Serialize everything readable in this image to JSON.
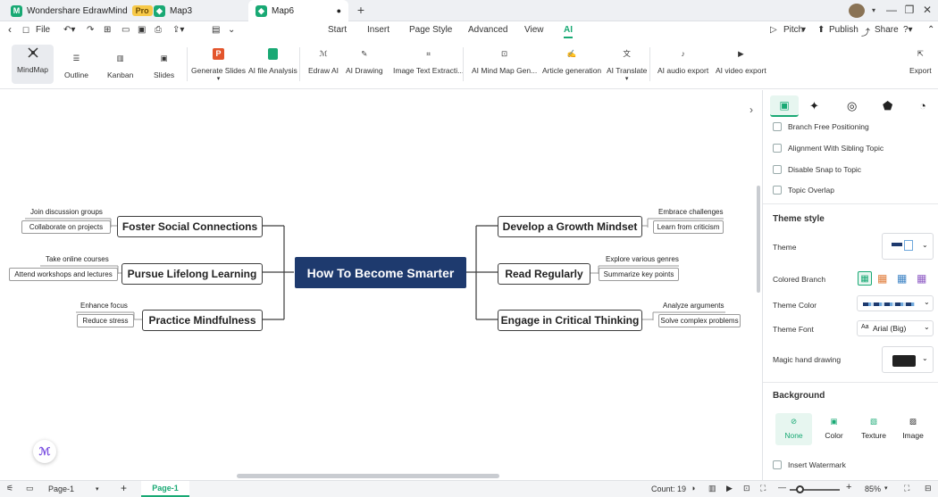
{
  "titlebar": {
    "app_tab": "Wondershare EdrawMind",
    "pro_badge": "Pro",
    "tabs": [
      "Map3",
      "Map6"
    ]
  },
  "menubar": {
    "file": "File",
    "items": [
      "Start",
      "Insert",
      "Page Style",
      "Advanced",
      "View",
      "AI"
    ],
    "active": "AI",
    "right": {
      "pitch": "Pitch",
      "publish": "Publish",
      "share": "Share"
    }
  },
  "ribbon": {
    "views": [
      "MindMap",
      "Outline",
      "Kanban",
      "Slides"
    ],
    "tools": [
      "Generate Slides",
      "AI file Analysis",
      "Edraw AI",
      "AI Drawing",
      "Image Text Extracti...",
      "AI Mind Map Gen...",
      "Article generation",
      "AI Translate",
      "AI audio export",
      "AI video export"
    ],
    "export": "Export"
  },
  "mindmap": {
    "central": "How To Become Smarter",
    "left": [
      {
        "topic": "Foster Social Connections",
        "subs": [
          "Join discussion groups",
          "Collaborate on projects"
        ]
      },
      {
        "topic": "Pursue Lifelong Learning",
        "subs": [
          "Take online courses",
          "Attend workshops and lectures"
        ]
      },
      {
        "topic": "Practice Mindfulness",
        "subs": [
          "Enhance focus",
          "Reduce stress"
        ]
      }
    ],
    "right": [
      {
        "topic": "Develop a Growth Mindset",
        "subs": [
          "Embrace challenges",
          "Learn from criticism"
        ]
      },
      {
        "topic": "Read Regularly",
        "subs": [
          "Explore various genres",
          "Summarize key points"
        ]
      },
      {
        "topic": "Engage in Critical Thinking",
        "subs": [
          "Analyze arguments",
          "Solve complex problems"
        ]
      }
    ]
  },
  "panel": {
    "checks": [
      "Branch Free Positioning",
      "Alignment With Sibling Topic",
      "Disable Snap to Topic",
      "Topic Overlap"
    ],
    "theme_style": "Theme style",
    "theme": "Theme",
    "colored_branch": "Colored Branch",
    "theme_color": "Theme Color",
    "theme_font": "Theme Font",
    "theme_font_value": "Arial (Big)",
    "magic": "Magic hand drawing",
    "background": "Background",
    "bg_options": [
      "None",
      "Color",
      "Texture",
      "Image"
    ],
    "watermark": "Insert Watermark"
  },
  "status": {
    "page_select": "Page-1",
    "page_tab": "Page-1",
    "count": "Count: 19",
    "zoom": "85%"
  },
  "colors": {
    "accent": "#19a974",
    "central": "#1e3a6e"
  }
}
